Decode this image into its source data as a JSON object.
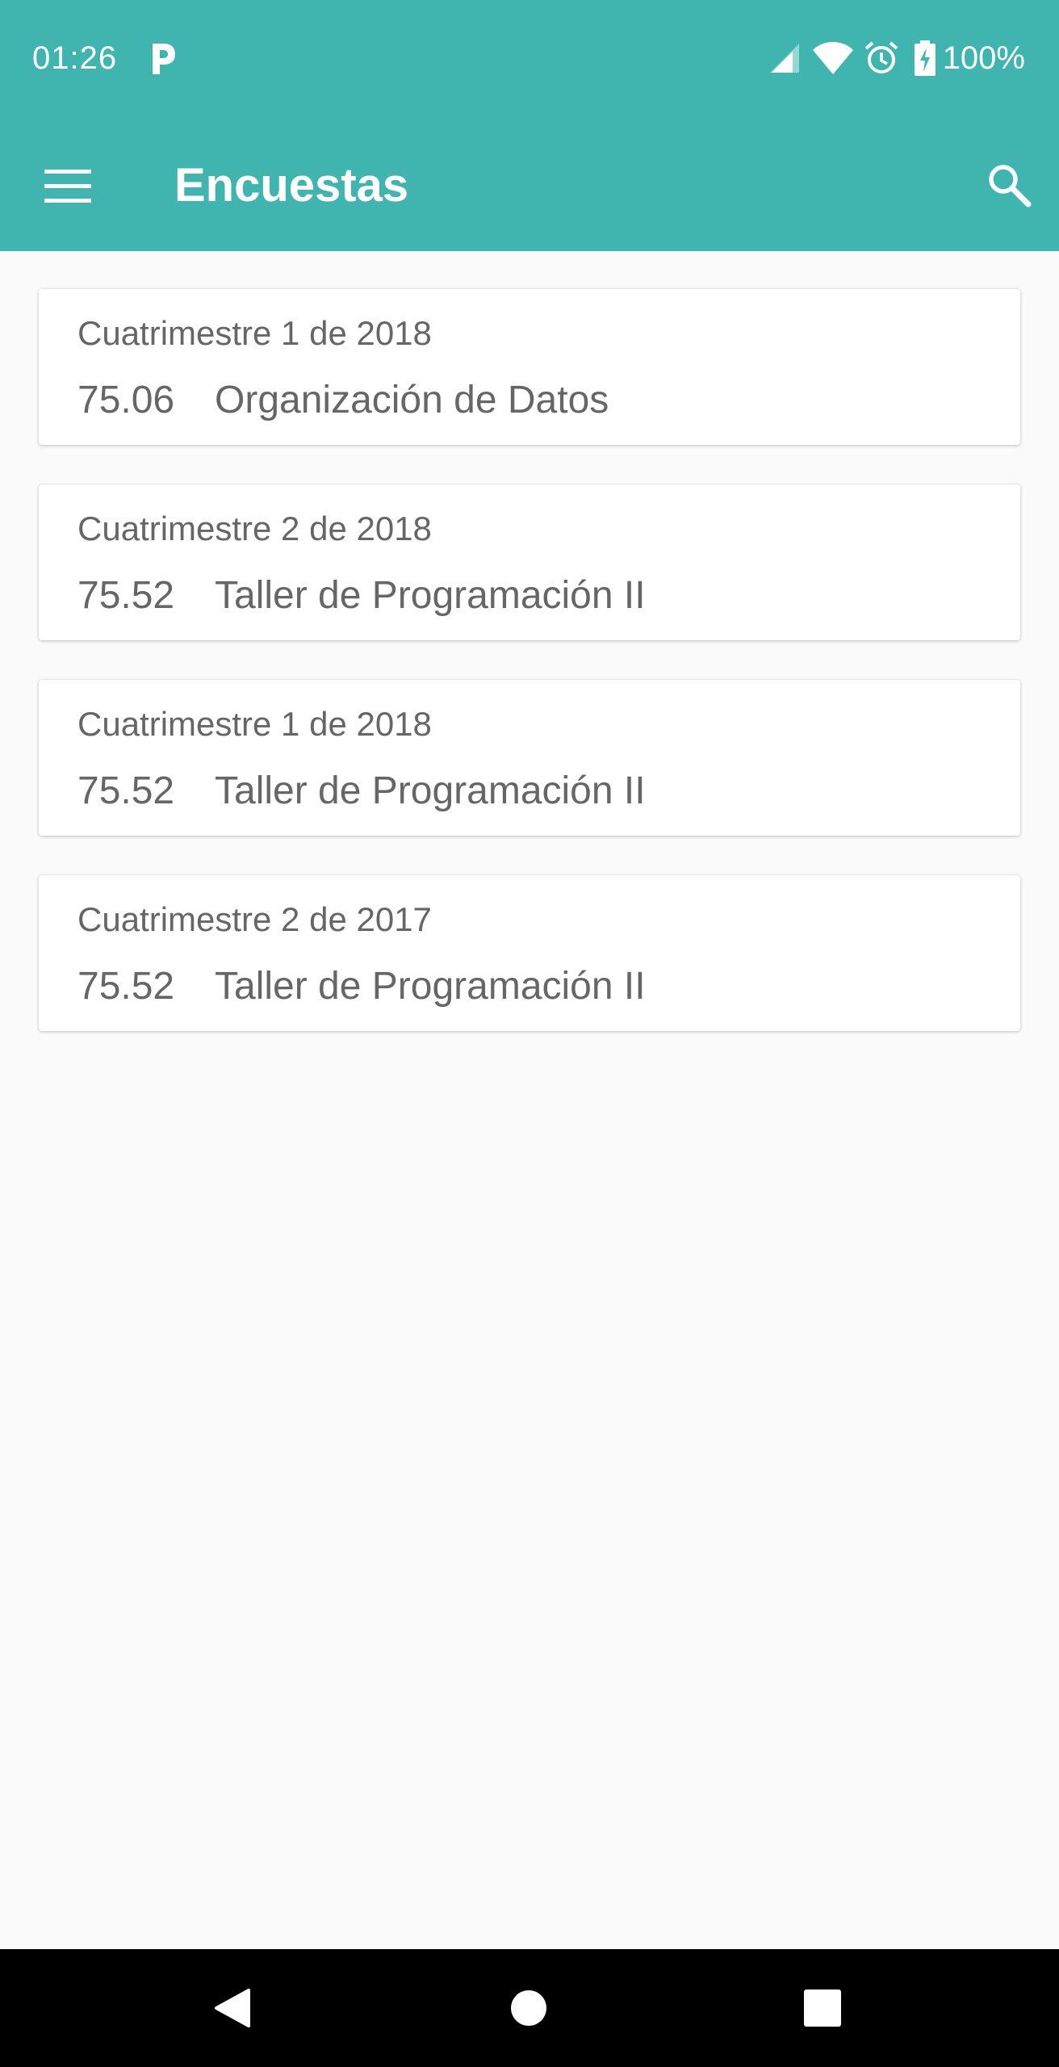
{
  "status_bar": {
    "time": "01:26",
    "battery": "100%",
    "icons": [
      "parking-app-icon",
      "signal-icon",
      "wifi-icon",
      "alarm-icon",
      "battery-charging-icon"
    ]
  },
  "toolbar": {
    "title": "Encuestas",
    "menu_icon": "hamburger-menu-icon",
    "search_icon": "search-icon"
  },
  "surveys": [
    {
      "term": "Cuatrimestre 1 de 2018",
      "code": "75.06",
      "name": "Organización de Datos"
    },
    {
      "term": "Cuatrimestre 2 de 2018",
      "code": "75.52",
      "name": "Taller de Programación II"
    },
    {
      "term": "Cuatrimestre 1 de 2018",
      "code": "75.52",
      "name": "Taller de Programación II"
    },
    {
      "term": "Cuatrimestre 2 de 2017",
      "code": "75.52",
      "name": "Taller de Programación II"
    }
  ],
  "nav_bar": {
    "buttons": [
      "back-icon",
      "home-icon",
      "recents-icon"
    ]
  },
  "colors": {
    "primary": "#40b5b0",
    "background": "#fafafa",
    "card": "#ffffff",
    "text_secondary": "#666666",
    "nav_bar": "#000000"
  }
}
